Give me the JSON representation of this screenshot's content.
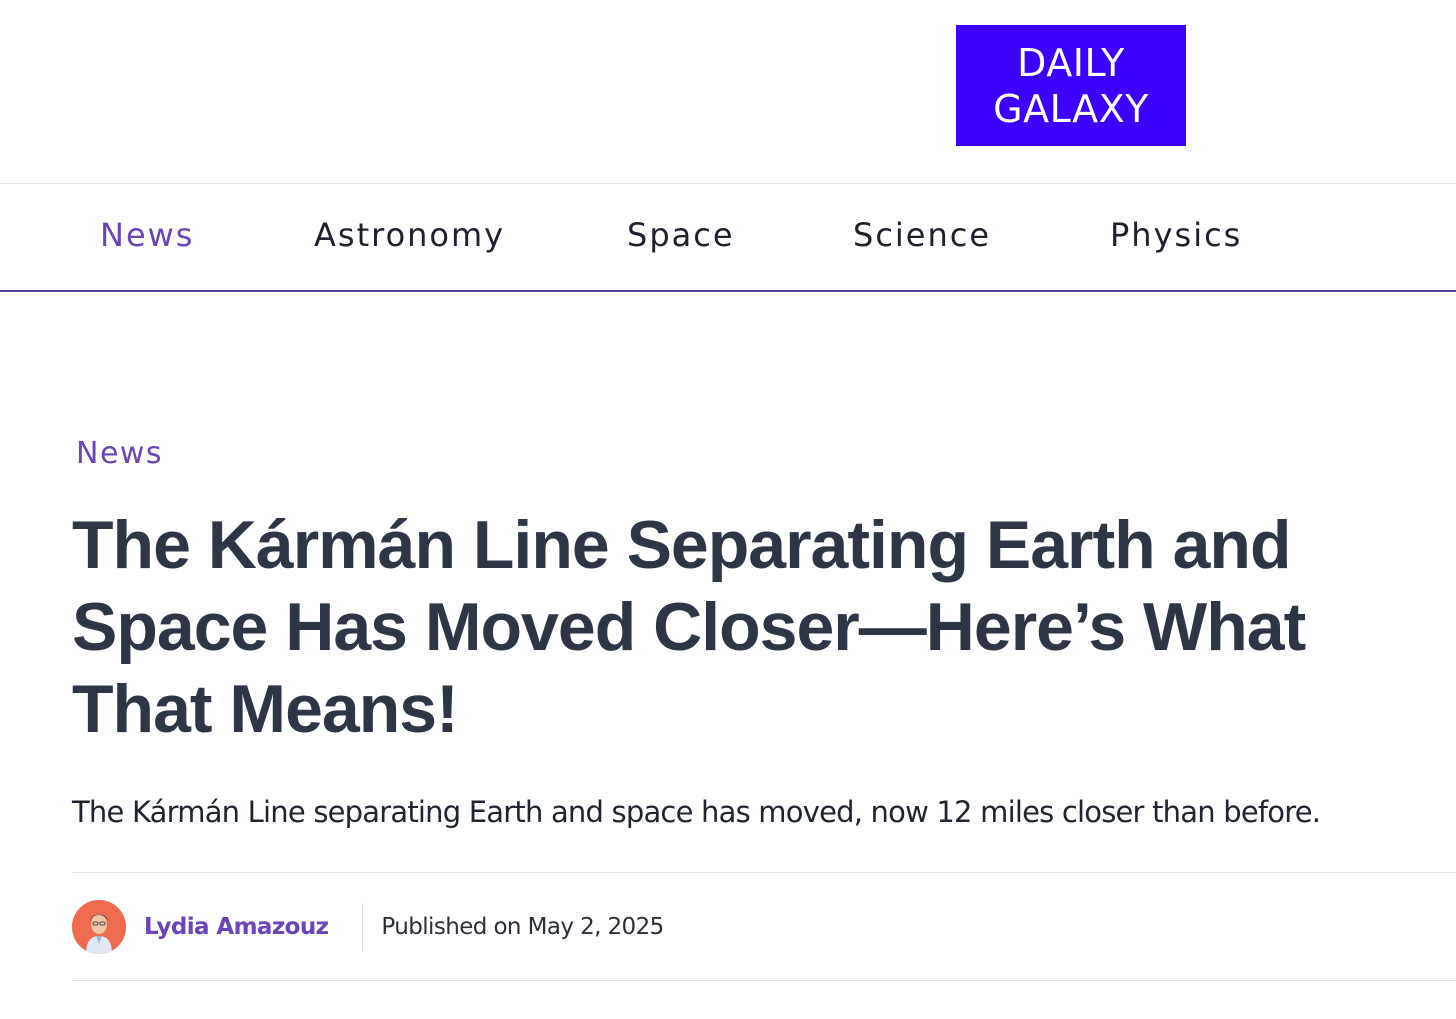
{
  "header": {
    "logo_line1": "DAILY",
    "logo_line2": "GALAXY"
  },
  "nav": {
    "items": [
      {
        "label": "News",
        "active": true
      },
      {
        "label": "Astronomy",
        "active": false
      },
      {
        "label": "Space",
        "active": false
      },
      {
        "label": "Science",
        "active": false
      },
      {
        "label": "Physics",
        "active": false
      }
    ]
  },
  "article": {
    "category": "News",
    "title": "The Kármán Line Separating Earth and Space Has Moved Closer—Here’s What That Means!",
    "subtitle": "The Kármán Line separating Earth and space has moved, now 12 miles closer than before.",
    "author": "Lydia Amazouz",
    "published": "Published on May 2, 2025"
  },
  "colors": {
    "logo_background": "#3b00ff",
    "accent": "#6a44b8",
    "title_text": "#2e3645",
    "nav_underline": "#5b3f9c",
    "avatar_background": "#ef6b4f"
  }
}
